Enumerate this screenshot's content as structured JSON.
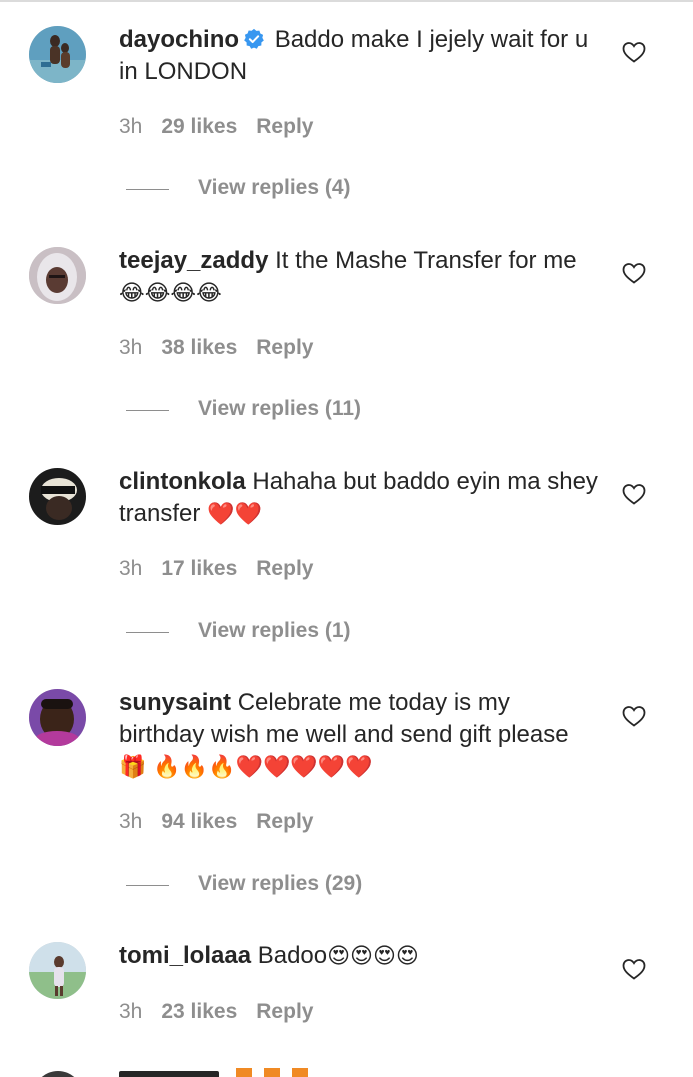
{
  "comments": [
    {
      "username": "dayochino",
      "verified": true,
      "text": "Baddo make I jejely wait for u in LONDON",
      "emoji": "",
      "time": "3h",
      "likes": "29 likes",
      "reply": "Reply",
      "view_replies": "View replies (4)"
    },
    {
      "username": "teejay_zaddy",
      "verified": false,
      "text": "It the Mashe Transfer for me",
      "emoji": "😂😂😂😂",
      "time": "3h",
      "likes": "38 likes",
      "reply": "Reply",
      "view_replies": "View replies (11)"
    },
    {
      "username": "clintonkola",
      "verified": false,
      "text": "Hahaha but baddo eyin ma shey transfer",
      "emoji": "❤️❤️",
      "time": "3h",
      "likes": "17 likes",
      "reply": "Reply",
      "view_replies": "View replies (1)"
    },
    {
      "username": "sunysaint",
      "verified": false,
      "text": "Celebrate me today is my birthday wish me well and send gift please",
      "emoji": "🎁 🔥🔥🔥❤️❤️❤️❤️❤️",
      "time": "3h",
      "likes": "94 likes",
      "reply": "Reply",
      "view_replies": "View replies (29)"
    },
    {
      "username": "tomi_lolaaa",
      "verified": false,
      "text": "Badoo",
      "emoji": "😍😍😍😍",
      "time": "3h",
      "likes": "23 likes",
      "reply": "Reply",
      "view_replies": ""
    }
  ],
  "colors": {
    "text": "#262626",
    "meta": "#8e8e8e",
    "verified_badge": "#3897f0",
    "heart_outline": "#262626"
  },
  "icons": {
    "like": "heart-outline-icon",
    "verified": "verified-badge-icon"
  }
}
